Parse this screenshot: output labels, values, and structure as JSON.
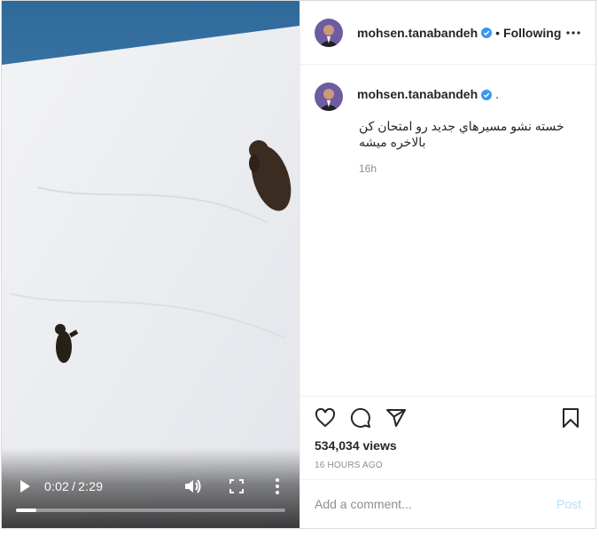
{
  "post": {
    "username": "mohsen.tanabandeh",
    "separator": "•",
    "follow_status": "Following",
    "caption_dot": ".",
    "caption_lines": [
      "خسته نشو مسیرهاي جديد رو امتحان كن",
      "بالاخره ميشه"
    ],
    "relative_time": "16h",
    "views": "534,034 views",
    "posted_ago": "16 HOURS AGO"
  },
  "video": {
    "current_time": "0:02",
    "separator": "/",
    "duration": "2:29",
    "progress_fraction": 0.075
  },
  "comment": {
    "placeholder": "Add a comment...",
    "post_label": "Post"
  },
  "colors": {
    "verified": "#3897f0",
    "post_button_disabled": "#b2dffc",
    "secondary_text": "#8e8e8e",
    "border": "#efefef"
  },
  "icons": {
    "header": [
      "verified-badge-icon",
      "more-options-icon"
    ],
    "actions": [
      "heart-icon",
      "comment-icon",
      "share-icon",
      "bookmark-icon"
    ],
    "video_controls": [
      "play-icon",
      "volume-icon",
      "fullscreen-icon",
      "more-vertical-icon"
    ]
  }
}
